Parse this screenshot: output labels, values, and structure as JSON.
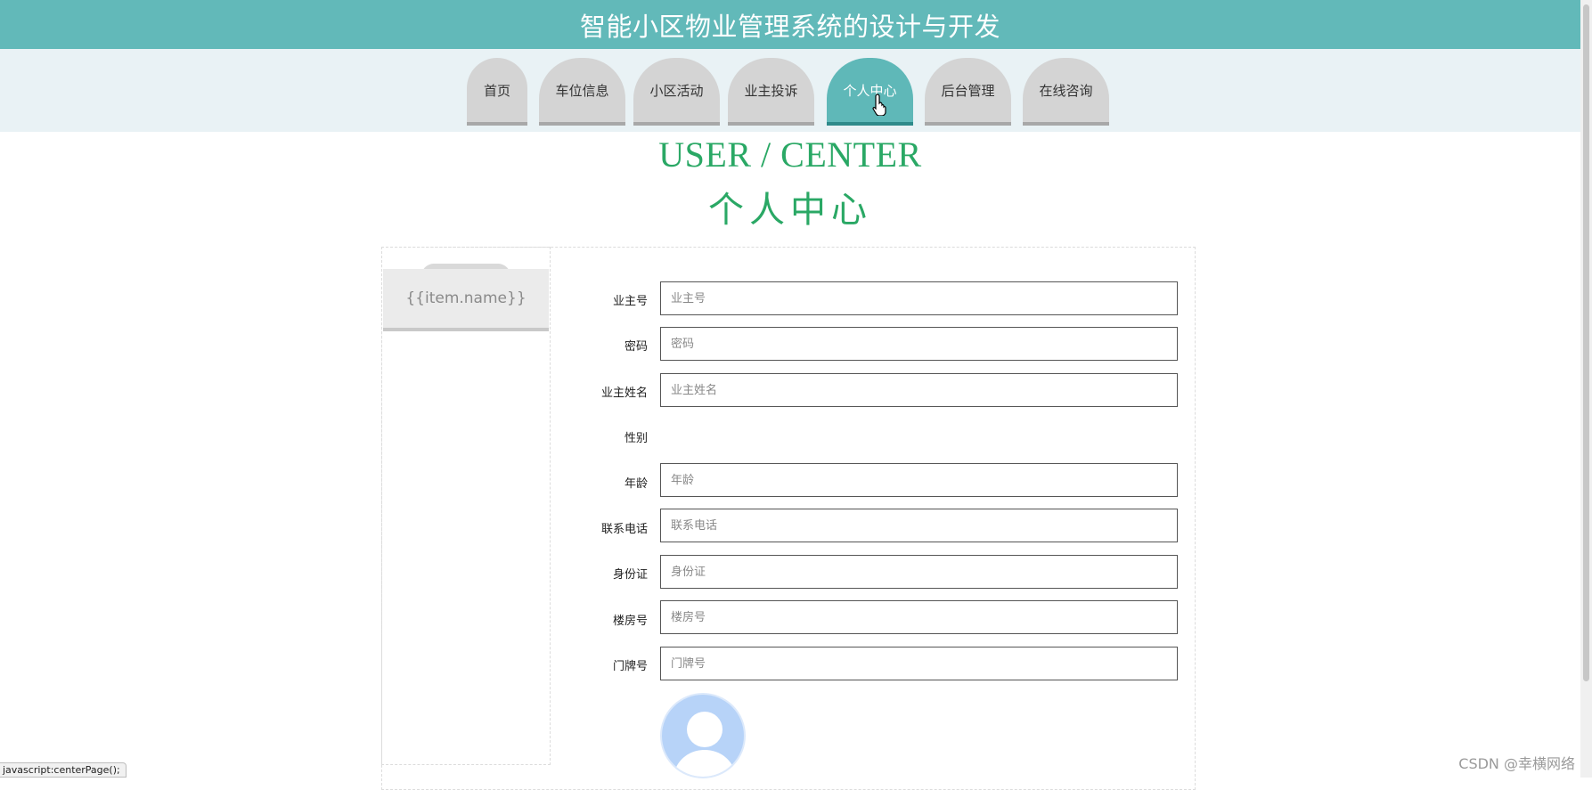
{
  "header": {
    "title": "智能小区物业管理系统的设计与开发"
  },
  "nav": {
    "tabs": [
      {
        "label": "首页"
      },
      {
        "label": "车位信息"
      },
      {
        "label": "小区活动"
      },
      {
        "label": "业主投诉"
      },
      {
        "label": "个人中心"
      },
      {
        "label": "后台管理"
      },
      {
        "label": "在线咨询"
      }
    ],
    "active_tab": "个人中心"
  },
  "page": {
    "title_en": "USER / CENTER",
    "title_cn": "个人中心"
  },
  "sidebar": {
    "items": [
      {
        "label": "{{item.name}}"
      }
    ]
  },
  "form": {
    "fields": [
      {
        "label": "业主号",
        "placeholder": "业主号",
        "value": ""
      },
      {
        "label": "密码",
        "placeholder": "密码",
        "value": ""
      },
      {
        "label": "业主姓名",
        "placeholder": "业主姓名",
        "value": ""
      },
      {
        "label": "性别"
      },
      {
        "label": "年龄",
        "placeholder": "年龄",
        "value": ""
      },
      {
        "label": "联系电话",
        "placeholder": "联系电话",
        "value": ""
      },
      {
        "label": "身份证",
        "placeholder": "身份证",
        "value": ""
      },
      {
        "label": "楼房号",
        "placeholder": "楼房号",
        "value": ""
      },
      {
        "label": "门牌号",
        "placeholder": "门牌号",
        "value": ""
      }
    ],
    "avatar_icon": "user-avatar-icon"
  },
  "status": {
    "text": "javascript:centerPage();"
  },
  "watermark": {
    "text": "CSDN @幸横网络"
  },
  "colors": {
    "header_bg": "#62b9b9",
    "nav_bg": "#e9f2f5",
    "tab_active": "#5fb8b8",
    "tab_inactive": "#d4d4d4",
    "heading": "#2aa865"
  }
}
